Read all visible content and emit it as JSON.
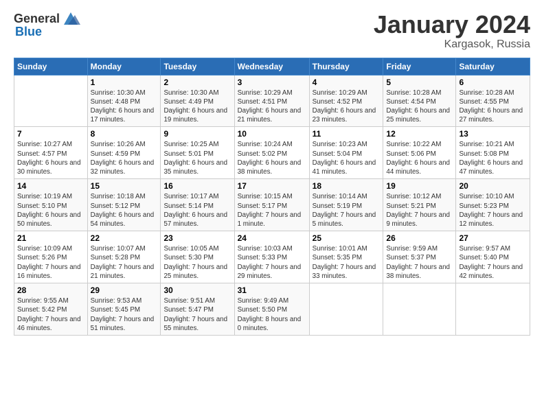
{
  "logo": {
    "text_general": "General",
    "text_blue": "Blue"
  },
  "title": {
    "month": "January 2024",
    "location": "Kargasok, Russia"
  },
  "weekdays": [
    "Sunday",
    "Monday",
    "Tuesday",
    "Wednesday",
    "Thursday",
    "Friday",
    "Saturday"
  ],
  "weeks": [
    [
      {
        "day": null
      },
      {
        "day": 1,
        "sunrise": "10:30 AM",
        "sunset": "4:48 PM",
        "daylight": "6 hours and 17 minutes."
      },
      {
        "day": 2,
        "sunrise": "10:30 AM",
        "sunset": "4:49 PM",
        "daylight": "6 hours and 19 minutes."
      },
      {
        "day": 3,
        "sunrise": "10:29 AM",
        "sunset": "4:51 PM",
        "daylight": "6 hours and 21 minutes."
      },
      {
        "day": 4,
        "sunrise": "10:29 AM",
        "sunset": "4:52 PM",
        "daylight": "6 hours and 23 minutes."
      },
      {
        "day": 5,
        "sunrise": "10:28 AM",
        "sunset": "4:54 PM",
        "daylight": "6 hours and 25 minutes."
      },
      {
        "day": 6,
        "sunrise": "10:28 AM",
        "sunset": "4:55 PM",
        "daylight": "6 hours and 27 minutes."
      }
    ],
    [
      {
        "day": 7,
        "sunrise": "10:27 AM",
        "sunset": "4:57 PM",
        "daylight": "6 hours and 30 minutes."
      },
      {
        "day": 8,
        "sunrise": "10:26 AM",
        "sunset": "4:59 PM",
        "daylight": "6 hours and 32 minutes."
      },
      {
        "day": 9,
        "sunrise": "10:25 AM",
        "sunset": "5:01 PM",
        "daylight": "6 hours and 35 minutes."
      },
      {
        "day": 10,
        "sunrise": "10:24 AM",
        "sunset": "5:02 PM",
        "daylight": "6 hours and 38 minutes."
      },
      {
        "day": 11,
        "sunrise": "10:23 AM",
        "sunset": "5:04 PM",
        "daylight": "6 hours and 41 minutes."
      },
      {
        "day": 12,
        "sunrise": "10:22 AM",
        "sunset": "5:06 PM",
        "daylight": "6 hours and 44 minutes."
      },
      {
        "day": 13,
        "sunrise": "10:21 AM",
        "sunset": "5:08 PM",
        "daylight": "6 hours and 47 minutes."
      }
    ],
    [
      {
        "day": 14,
        "sunrise": "10:19 AM",
        "sunset": "5:10 PM",
        "daylight": "6 hours and 50 minutes."
      },
      {
        "day": 15,
        "sunrise": "10:18 AM",
        "sunset": "5:12 PM",
        "daylight": "6 hours and 54 minutes."
      },
      {
        "day": 16,
        "sunrise": "10:17 AM",
        "sunset": "5:14 PM",
        "daylight": "6 hours and 57 minutes."
      },
      {
        "day": 17,
        "sunrise": "10:15 AM",
        "sunset": "5:17 PM",
        "daylight": "7 hours and 1 minute."
      },
      {
        "day": 18,
        "sunrise": "10:14 AM",
        "sunset": "5:19 PM",
        "daylight": "7 hours and 5 minutes."
      },
      {
        "day": 19,
        "sunrise": "10:12 AM",
        "sunset": "5:21 PM",
        "daylight": "7 hours and 9 minutes."
      },
      {
        "day": 20,
        "sunrise": "10:10 AM",
        "sunset": "5:23 PM",
        "daylight": "7 hours and 12 minutes."
      }
    ],
    [
      {
        "day": 21,
        "sunrise": "10:09 AM",
        "sunset": "5:26 PM",
        "daylight": "7 hours and 16 minutes."
      },
      {
        "day": 22,
        "sunrise": "10:07 AM",
        "sunset": "5:28 PM",
        "daylight": "7 hours and 21 minutes."
      },
      {
        "day": 23,
        "sunrise": "10:05 AM",
        "sunset": "5:30 PM",
        "daylight": "7 hours and 25 minutes."
      },
      {
        "day": 24,
        "sunrise": "10:03 AM",
        "sunset": "5:33 PM",
        "daylight": "7 hours and 29 minutes."
      },
      {
        "day": 25,
        "sunrise": "10:01 AM",
        "sunset": "5:35 PM",
        "daylight": "7 hours and 33 minutes."
      },
      {
        "day": 26,
        "sunrise": "9:59 AM",
        "sunset": "5:37 PM",
        "daylight": "7 hours and 38 minutes."
      },
      {
        "day": 27,
        "sunrise": "9:57 AM",
        "sunset": "5:40 PM",
        "daylight": "7 hours and 42 minutes."
      }
    ],
    [
      {
        "day": 28,
        "sunrise": "9:55 AM",
        "sunset": "5:42 PM",
        "daylight": "7 hours and 46 minutes."
      },
      {
        "day": 29,
        "sunrise": "9:53 AM",
        "sunset": "5:45 PM",
        "daylight": "7 hours and 51 minutes."
      },
      {
        "day": 30,
        "sunrise": "9:51 AM",
        "sunset": "5:47 PM",
        "daylight": "7 hours and 55 minutes."
      },
      {
        "day": 31,
        "sunrise": "9:49 AM",
        "sunset": "5:50 PM",
        "daylight": "8 hours and 0 minutes."
      },
      {
        "day": null
      },
      {
        "day": null
      },
      {
        "day": null
      }
    ]
  ]
}
